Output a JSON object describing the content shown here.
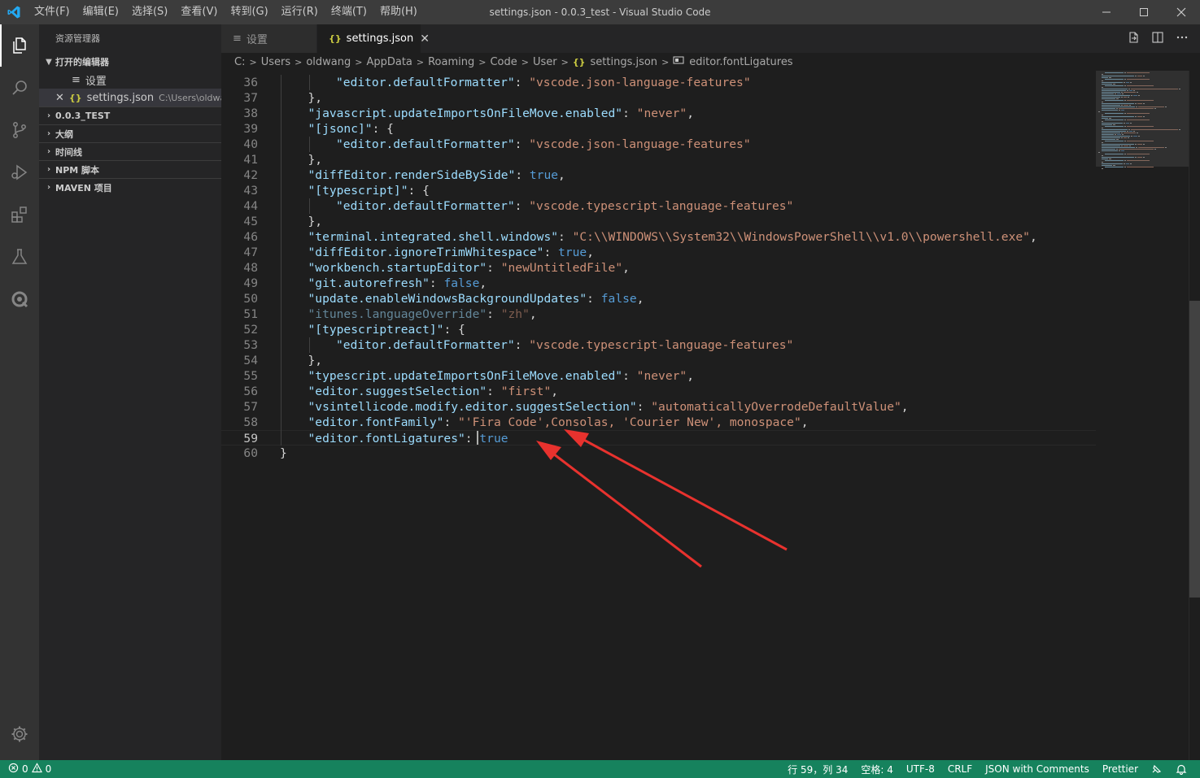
{
  "window": {
    "title": "settings.json - 0.0.3_test - Visual Studio Code"
  },
  "menu": [
    "文件(F)",
    "编辑(E)",
    "选择(S)",
    "查看(V)",
    "转到(G)",
    "运行(R)",
    "终端(T)",
    "帮助(H)"
  ],
  "sidebar": {
    "title": "资源管理器",
    "open_editors": {
      "label": "打开的编辑器",
      "items": [
        {
          "icon": "≡",
          "name": "设置",
          "path": ""
        },
        {
          "icon": "{}",
          "name": "settings.json",
          "path": "C:\\Users\\oldwa..."
        }
      ]
    },
    "sections": [
      "0.0.3_TEST",
      "大纲",
      "时间线",
      "NPM 脚本",
      "MAVEN 项目"
    ]
  },
  "tabs": [
    {
      "label": "设置",
      "icon": "≡",
      "active": false
    },
    {
      "label": "settings.json",
      "icon": "{}",
      "active": true
    }
  ],
  "breadcrumb": [
    "C:",
    "Users",
    "oldwang",
    "AppData",
    "Roaming",
    "Code",
    "User",
    "settings.json",
    "editor.fontLigatures"
  ],
  "editor": {
    "current_line": 59,
    "lines": [
      {
        "n": "36",
        "indent": 2,
        "t": [
          [
            "k",
            "\"editor.defaultFormatter\""
          ],
          [
            "p",
            ": "
          ],
          [
            "s",
            "\"vscode.json-language-features\""
          ]
        ]
      },
      {
        "n": "37",
        "indent": 1,
        "t": [
          [
            "p",
            "},"
          ]
        ]
      },
      {
        "n": "38",
        "indent": 1,
        "t": [
          [
            "k",
            "\"javascript.updateImportsOnFileMove.enabled\""
          ],
          [
            "p",
            ": "
          ],
          [
            "s",
            "\"never\""
          ],
          [
            "p",
            ","
          ]
        ]
      },
      {
        "n": "39",
        "indent": 1,
        "t": [
          [
            "k",
            "\"[jsonc]\""
          ],
          [
            "p",
            ": {"
          ]
        ]
      },
      {
        "n": "40",
        "indent": 2,
        "t": [
          [
            "k",
            "\"editor.defaultFormatter\""
          ],
          [
            "p",
            ": "
          ],
          [
            "s",
            "\"vscode.json-language-features\""
          ]
        ]
      },
      {
        "n": "41",
        "indent": 1,
        "t": [
          [
            "p",
            "},"
          ]
        ]
      },
      {
        "n": "42",
        "indent": 1,
        "t": [
          [
            "k",
            "\"diffEditor.renderSideBySide\""
          ],
          [
            "p",
            ": "
          ],
          [
            "b",
            "true"
          ],
          [
            "p",
            ","
          ]
        ]
      },
      {
        "n": "43",
        "indent": 1,
        "t": [
          [
            "k",
            "\"[typescript]\""
          ],
          [
            "p",
            ": {"
          ]
        ]
      },
      {
        "n": "44",
        "indent": 2,
        "t": [
          [
            "k",
            "\"editor.defaultFormatter\""
          ],
          [
            "p",
            ": "
          ],
          [
            "s",
            "\"vscode.typescript-language-features\""
          ]
        ]
      },
      {
        "n": "45",
        "indent": 1,
        "t": [
          [
            "p",
            "},"
          ]
        ]
      },
      {
        "n": "46",
        "indent": 1,
        "t": [
          [
            "k",
            "\"terminal.integrated.shell.windows\""
          ],
          [
            "p",
            ": "
          ],
          [
            "s",
            "\"C:\\\\WINDOWS\\\\System32\\\\WindowsPowerShell\\\\v1.0\\\\powershell.exe\""
          ],
          [
            "p",
            ","
          ]
        ]
      },
      {
        "n": "47",
        "indent": 1,
        "t": [
          [
            "k",
            "\"diffEditor.ignoreTrimWhitespace\""
          ],
          [
            "p",
            ": "
          ],
          [
            "b",
            "true"
          ],
          [
            "p",
            ","
          ]
        ]
      },
      {
        "n": "48",
        "indent": 1,
        "t": [
          [
            "k",
            "\"workbench.startupEditor\""
          ],
          [
            "p",
            ": "
          ],
          [
            "s",
            "\"newUntitledFile\""
          ],
          [
            "p",
            ","
          ]
        ]
      },
      {
        "n": "49",
        "indent": 1,
        "t": [
          [
            "k",
            "\"git.autorefresh\""
          ],
          [
            "p",
            ": "
          ],
          [
            "b",
            "false"
          ],
          [
            "p",
            ","
          ]
        ]
      },
      {
        "n": "50",
        "indent": 1,
        "t": [
          [
            "k",
            "\"update.enableWindowsBackgroundUpdates\""
          ],
          [
            "p",
            ": "
          ],
          [
            "b",
            "false"
          ],
          [
            "p",
            ","
          ]
        ]
      },
      {
        "n": "51",
        "indent": 1,
        "t": [
          [
            "kd",
            "\"itunes.languageOverride\""
          ],
          [
            "p",
            ": "
          ],
          [
            "sd",
            "\"zh\""
          ],
          [
            "p",
            ","
          ]
        ]
      },
      {
        "n": "52",
        "indent": 1,
        "t": [
          [
            "k",
            "\"[typescriptreact]\""
          ],
          [
            "p",
            ": {"
          ]
        ]
      },
      {
        "n": "53",
        "indent": 2,
        "t": [
          [
            "k",
            "\"editor.defaultFormatter\""
          ],
          [
            "p",
            ": "
          ],
          [
            "s",
            "\"vscode.typescript-language-features\""
          ]
        ]
      },
      {
        "n": "54",
        "indent": 1,
        "t": [
          [
            "p",
            "},"
          ]
        ]
      },
      {
        "n": "55",
        "indent": 1,
        "t": [
          [
            "k",
            "\"typescript.updateImportsOnFileMove.enabled\""
          ],
          [
            "p",
            ": "
          ],
          [
            "s",
            "\"never\""
          ],
          [
            "p",
            ","
          ]
        ]
      },
      {
        "n": "56",
        "indent": 1,
        "t": [
          [
            "k",
            "\"editor.suggestSelection\""
          ],
          [
            "p",
            ": "
          ],
          [
            "s",
            "\"first\""
          ],
          [
            "p",
            ","
          ]
        ]
      },
      {
        "n": "57",
        "indent": 1,
        "t": [
          [
            "k",
            "\"vsintellicode.modify.editor.suggestSelection\""
          ],
          [
            "p",
            ": "
          ],
          [
            "s",
            "\"automaticallyOverrodeDefaultValue\""
          ],
          [
            "p",
            ","
          ]
        ]
      },
      {
        "n": "58",
        "indent": 1,
        "t": [
          [
            "k",
            "\"editor.fontFamily\""
          ],
          [
            "p",
            ": "
          ],
          [
            "s",
            "\"'Fira Code',Consolas, 'Courier New', monospace\""
          ],
          [
            "p",
            ","
          ]
        ]
      },
      {
        "n": "59",
        "indent": 1,
        "t": [
          [
            "k",
            "\"editor.fontLigatures\""
          ],
          [
            "p",
            ": "
          ],
          [
            "b",
            "true"
          ]
        ]
      },
      {
        "n": "60",
        "indent": 0,
        "t": [
          [
            "p",
            "}"
          ]
        ]
      }
    ]
  },
  "statusbar": {
    "errors": "0",
    "warnings": "0",
    "position": "行 59，列 34",
    "spaces": "空格: 4",
    "encoding": "UTF-8",
    "eol": "CRLF",
    "language": "JSON with Comments",
    "formatter": "Prettier"
  },
  "colors": {
    "status_bar": "#16825d",
    "annotation_arrow": "#e8322e",
    "accent": "#007acc"
  }
}
